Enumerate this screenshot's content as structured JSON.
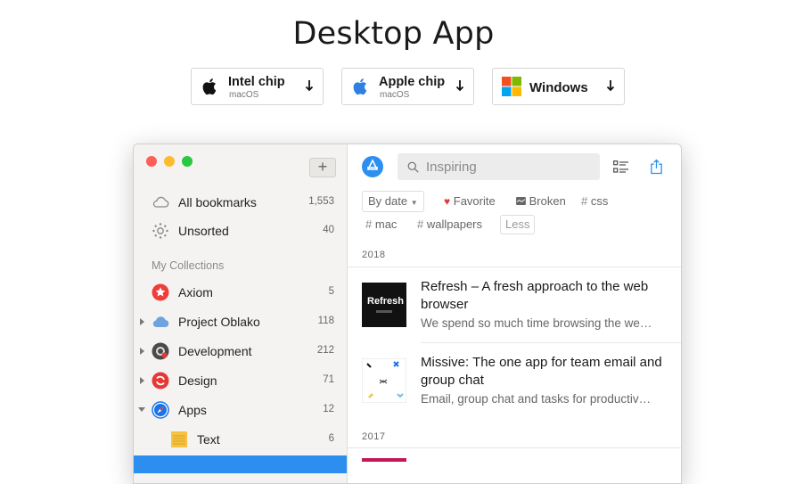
{
  "page": {
    "title": "Desktop App"
  },
  "downloads": [
    {
      "label": "Intel chip",
      "sub": "macOS",
      "icon": "apple-icon"
    },
    {
      "label": "Apple chip",
      "sub": "macOS",
      "icon": "apple-icon"
    },
    {
      "label": "Windows",
      "sub": "",
      "icon": "windows-icon"
    }
  ],
  "sidebar": {
    "add_label": "+",
    "items": [
      {
        "label": "All bookmarks",
        "count": "1,553",
        "icon": "cloud-icon"
      },
      {
        "label": "Unsorted",
        "count": "40",
        "icon": "dotted-circle-icon"
      }
    ],
    "section_title": "My Collections",
    "collections": [
      {
        "label": "Axiom",
        "count": "5",
        "icon": "star-badge-icon",
        "color": "#ef3e3a"
      },
      {
        "label": "Project Oblako",
        "count": "118",
        "icon": "cloud-icon",
        "color": "#6ea3df"
      },
      {
        "label": "Development",
        "count": "212",
        "icon": "gear-icon",
        "color": "#4a4a4a"
      },
      {
        "label": "Design",
        "count": "71",
        "icon": "swirl-icon",
        "color": "#e53935"
      },
      {
        "label": "Apps",
        "count": "12",
        "icon": "compass-icon",
        "color": "#1a73e8"
      },
      {
        "label": "Text",
        "count": "6",
        "icon": "notepad-icon",
        "color": "#f5c242"
      }
    ]
  },
  "main": {
    "search_placeholder": "Inspiring",
    "sort_label": "By date",
    "filters": [
      {
        "label": "Favorite",
        "prefix": "♥"
      },
      {
        "label": "Broken",
        "prefix": ""
      },
      {
        "label": "css",
        "prefix": "#"
      },
      {
        "label": "mac",
        "prefix": "#"
      },
      {
        "label": "wallpapers",
        "prefix": "#"
      }
    ],
    "less_label": "Less",
    "groups": [
      {
        "year": "2018",
        "items": [
          {
            "title": "Refresh – A fresh approach to the web browser",
            "excerpt": "We spend so much time browsing the we…",
            "thumb_text": "Refresh"
          },
          {
            "title": "Missive: The one app for team email and group chat",
            "excerpt": "Email, group chat and tasks for productiv…",
            "thumb_text": ""
          }
        ]
      },
      {
        "year": "2017",
        "items": []
      }
    ]
  },
  "colors": {
    "accent": "#2c8ff0",
    "mac_red": "#fe5f57",
    "mac_yellow": "#febb2e",
    "mac_green": "#28c840"
  }
}
